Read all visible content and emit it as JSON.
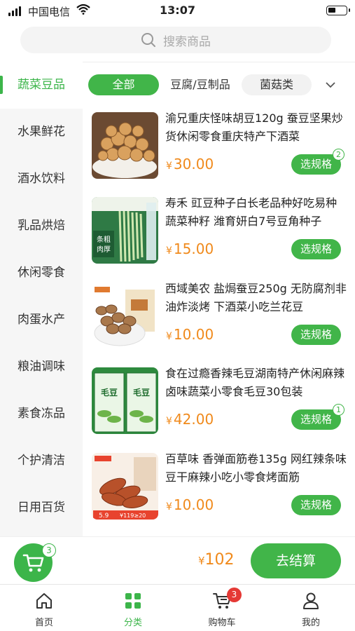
{
  "status": {
    "carrier": "中国电信",
    "time": "13:07"
  },
  "search": {
    "placeholder": "搜索商品"
  },
  "categories": [
    "蔬菜豆品",
    "水果鲜花",
    "酒水饮料",
    "乳品烘焙",
    "休闲零食",
    "肉蛋水产",
    "粮油调味",
    "素食冻品",
    "个护清洁",
    "日用百货"
  ],
  "filters": {
    "all": "全部",
    "tofu": "豆腐/豆制品",
    "mushroom": "菌菇类"
  },
  "products": [
    {
      "title": "渝兄重庆怪味胡豆120g 蚕豆坚果炒货休闲零食重庆特产下酒菜",
      "price": "30.00",
      "badge": "2"
    },
    {
      "title": "寿禾 豇豆种子白长老品种好吃易种蔬菜种籽 潍育妍白7号豆角种子",
      "price": "15.00",
      "badge": ""
    },
    {
      "title": "西域美农 盐焗蚕豆250g 无防腐剂非油炸淡烤 下酒菜小吃兰花豆",
      "price": "10.00",
      "badge": ""
    },
    {
      "title": "食在过瘾香辣毛豆湖南特产休闲麻辣卤味蔬菜小零食毛豆30包装",
      "price": "42.00",
      "badge": "1"
    },
    {
      "title": "百草味 香弹面筋卷135g 网红辣条味豆干麻辣小吃小零食烤面筋",
      "price": "10.00",
      "badge": ""
    }
  ],
  "currency": "¥",
  "spec_label": "选规格",
  "thumb_text": {
    "p2a": "条粗",
    "p2b": "肉厚",
    "p4": "毛豆",
    "p5a": "5.9",
    "p5b": "¥119≥20"
  },
  "cart": {
    "count": "3",
    "total": "102",
    "checkout": "去结算"
  },
  "tabs": [
    {
      "label": "首页",
      "icon": "home-icon"
    },
    {
      "label": "分类",
      "icon": "category-icon"
    },
    {
      "label": "购物车",
      "icon": "cart-icon",
      "badge": "3"
    },
    {
      "label": "我的",
      "icon": "profile-icon"
    }
  ],
  "colors": {
    "brand": "#41b549",
    "price": "#f08a1c",
    "badge": "#e53935"
  }
}
